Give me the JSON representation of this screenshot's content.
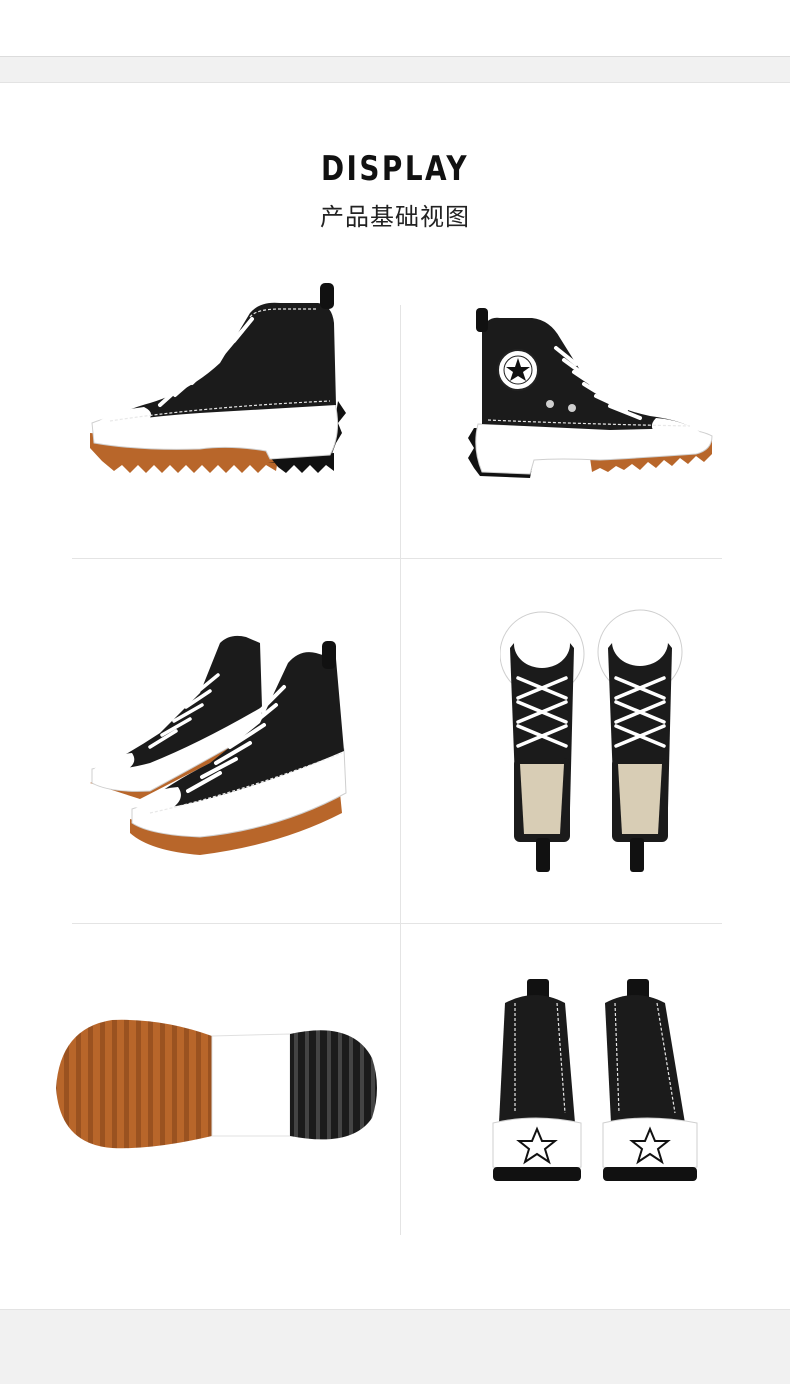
{
  "header": {
    "title": "DISPLAY",
    "subtitle": "产品基础视图"
  },
  "colors": {
    "canvas": "#1b1b1b",
    "sole": "#ffffff",
    "gum": "#b8662a",
    "lace": "#ffffff",
    "stitch": "#e8e8e8",
    "lining": "#d8cdb5"
  },
  "views": [
    {
      "id": "outer-side",
      "icon": "shoe-side-right-icon"
    },
    {
      "id": "inner-side",
      "icon": "shoe-side-left-icon"
    },
    {
      "id": "pair-angle",
      "icon": "shoe-pair-angle-icon"
    },
    {
      "id": "pair-top",
      "icon": "shoe-pair-top-icon"
    },
    {
      "id": "outsole",
      "icon": "shoe-outsole-icon"
    },
    {
      "id": "pair-back",
      "icon": "shoe-pair-back-icon"
    }
  ]
}
